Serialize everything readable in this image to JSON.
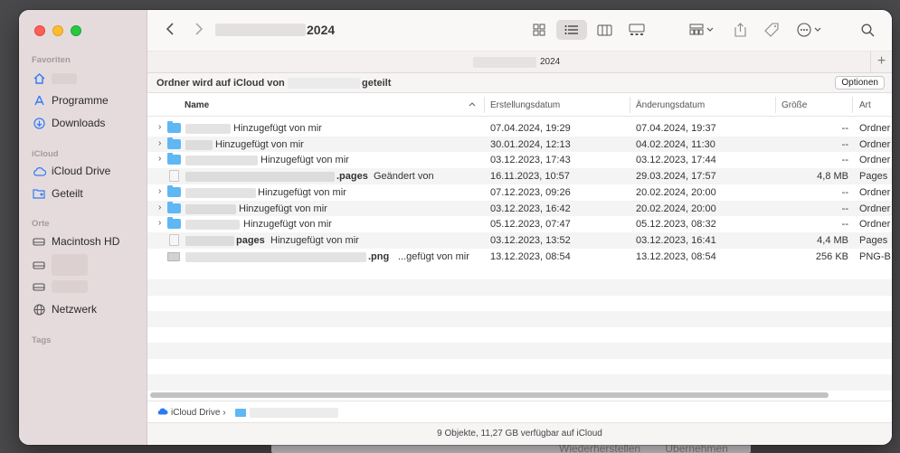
{
  "background_app": {
    "buttons": [
      "Wiederherstellen",
      "Übernehmen"
    ]
  },
  "window": {
    "title": "2024",
    "tab_title": "2024"
  },
  "sidebar": {
    "sections": [
      {
        "heading": "Favoriten",
        "items": [
          {
            "label": "",
            "icon": "home-icon"
          },
          {
            "label": "Programme",
            "icon": "apps-icon"
          },
          {
            "label": "Downloads",
            "icon": "download-icon"
          }
        ]
      },
      {
        "heading": "iCloud",
        "items": [
          {
            "label": "iCloud Drive",
            "icon": "cloud-icon"
          },
          {
            "label": "Geteilt",
            "icon": "shared-folder-icon"
          }
        ]
      },
      {
        "heading": "Orte",
        "items": [
          {
            "label": "Macintosh HD",
            "icon": "disk-icon"
          },
          {
            "label": "",
            "icon": "disk-icon"
          },
          {
            "label": "",
            "icon": "disk-icon"
          },
          {
            "label": "Netzwerk",
            "icon": "globe-icon"
          }
        ]
      },
      {
        "heading": "Tags",
        "items": []
      }
    ]
  },
  "share_banner": {
    "text_before": "Ordner wird auf iCloud von",
    "text_after": "geteilt",
    "options_label": "Optionen"
  },
  "columns": {
    "name": "Name",
    "created": "Erstellungsdatum",
    "modified": "Änderungsdatum",
    "size": "Größe",
    "kind": "Art"
  },
  "files": [
    {
      "type": "folder",
      "name_visible": "Hinzugefügt von mir",
      "created": "07.04.2024, 19:29",
      "modified": "07.04.2024, 19:37",
      "size": "--",
      "kind": "Ordner"
    },
    {
      "type": "folder",
      "name_visible": "Hinzugefügt von mir",
      "created": "30.01.2024, 12:13",
      "modified": "04.02.2024, 11:30",
      "size": "--",
      "kind": "Ordner"
    },
    {
      "type": "folder",
      "name_visible": "Hinzugefügt von mir",
      "created": "03.12.2023, 17:43",
      "modified": "03.12.2023, 17:44",
      "size": "--",
      "kind": "Ordner"
    },
    {
      "type": "doc",
      "name_suffix": ".pages",
      "name_visible": "Geändert von",
      "created": "16.11.2023, 10:57",
      "modified": "29.03.2024, 17:57",
      "size": "4,8 MB",
      "kind": "Pages"
    },
    {
      "type": "folder",
      "name_visible": "Hinzugefügt von mir",
      "created": "07.12.2023, 09:26",
      "modified": "20.02.2024, 20:00",
      "size": "--",
      "kind": "Ordner"
    },
    {
      "type": "folder",
      "name_visible": "Hinzugefügt von mir",
      "created": "03.12.2023, 16:42",
      "modified": "20.02.2024, 20:00",
      "size": "--",
      "kind": "Ordner"
    },
    {
      "type": "folder",
      "name_visible": "Hinzugefügt von mir",
      "created": "05.12.2023, 07:47",
      "modified": "05.12.2023, 08:32",
      "size": "--",
      "kind": "Ordner"
    },
    {
      "type": "doc",
      "name_suffix": "pages",
      "name_visible": "Hinzugefügt von mir",
      "created": "03.12.2023, 13:52",
      "modified": "03.12.2023, 16:41",
      "size": "4,4 MB",
      "kind": "Pages"
    },
    {
      "type": "image",
      "name_suffix": ".png",
      "name_visible": "...gefügt von mir",
      "created": "13.12.2023, 08:54",
      "modified": "13.12.2023, 08:54",
      "size": "256 KB",
      "kind": "PNG-B"
    }
  ],
  "pathbar": {
    "root": "iCloud Drive"
  },
  "status": "9 Objekte, 11,27 GB verfügbar auf iCloud"
}
